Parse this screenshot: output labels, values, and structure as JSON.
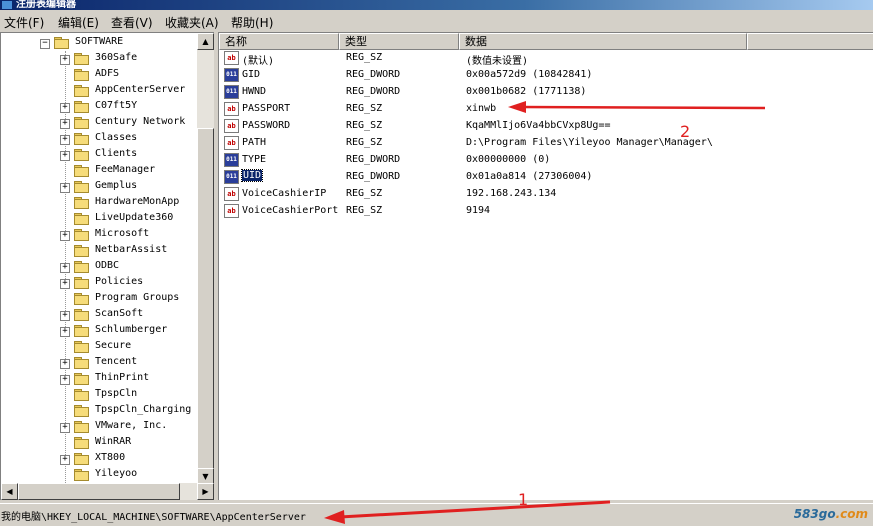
{
  "window": {
    "title": "注册表编辑器"
  },
  "menu": [
    {
      "label": "文件(F)"
    },
    {
      "label": "编辑(E)"
    },
    {
      "label": "查看(V)"
    },
    {
      "label": "收藏夹(A)"
    },
    {
      "label": "帮助(H)"
    }
  ],
  "tree": {
    "root": {
      "label": "SOFTWARE",
      "expander": "−"
    },
    "items": [
      {
        "label": "360Safe",
        "expander": "+"
      },
      {
        "label": "ADFS",
        "expander": ""
      },
      {
        "label": "AppCenterServer",
        "expander": ""
      },
      {
        "label": "C07ft5Y",
        "expander": "+"
      },
      {
        "label": "Century Network",
        "expander": "+"
      },
      {
        "label": "Classes",
        "expander": "+"
      },
      {
        "label": "Clients",
        "expander": "+"
      },
      {
        "label": "FeeManager",
        "expander": ""
      },
      {
        "label": "Gemplus",
        "expander": "+"
      },
      {
        "label": "HardwareMonApp",
        "expander": ""
      },
      {
        "label": "LiveUpdate360",
        "expander": ""
      },
      {
        "label": "Microsoft",
        "expander": "+"
      },
      {
        "label": "NetbarAssist",
        "expander": ""
      },
      {
        "label": "ODBC",
        "expander": "+"
      },
      {
        "label": "Policies",
        "expander": "+"
      },
      {
        "label": "Program Groups",
        "expander": ""
      },
      {
        "label": "ScanSoft",
        "expander": "+"
      },
      {
        "label": "Schlumberger",
        "expander": "+"
      },
      {
        "label": "Secure",
        "expander": ""
      },
      {
        "label": "Tencent",
        "expander": "+"
      },
      {
        "label": "ThinPrint",
        "expander": "+"
      },
      {
        "label": "TpspCln",
        "expander": ""
      },
      {
        "label": "TpspCln_Charging",
        "expander": ""
      },
      {
        "label": "VMware, Inc.",
        "expander": "+"
      },
      {
        "label": "WinRAR",
        "expander": ""
      },
      {
        "label": "XT800",
        "expander": "+"
      },
      {
        "label": "Yileyoo",
        "expander": ""
      }
    ]
  },
  "scroll": {
    "up": "▲",
    "down": "▼",
    "left": "◀",
    "right": "▶"
  },
  "columns": {
    "name": "名称",
    "type": "类型",
    "data": "数据"
  },
  "values": [
    {
      "icon": "ab",
      "name": "(默认)",
      "type": "REG_SZ",
      "data": "(数值未设置)",
      "selected": false
    },
    {
      "icon": "011",
      "name": "GID",
      "type": "REG_DWORD",
      "data": "0x00a572d9 (10842841)",
      "selected": false
    },
    {
      "icon": "011",
      "name": "HWND",
      "type": "REG_DWORD",
      "data": "0x001b0682 (1771138)",
      "selected": false
    },
    {
      "icon": "ab",
      "name": "PASSPORT",
      "type": "REG_SZ",
      "data": "xinwb",
      "selected": false
    },
    {
      "icon": "ab",
      "name": "PASSWORD",
      "type": "REG_SZ",
      "data": "KqaMMlIjo6Va4bbCVxp8Ug==",
      "selected": false
    },
    {
      "icon": "ab",
      "name": "PATH",
      "type": "REG_SZ",
      "data": "D:\\Program Files\\Yileyoo Manager\\Manager\\",
      "selected": false
    },
    {
      "icon": "011",
      "name": "TYPE",
      "type": "REG_DWORD",
      "data": "0x00000000 (0)",
      "selected": false
    },
    {
      "icon": "011",
      "name": "UID",
      "type": "REG_DWORD",
      "data": "0x01a0a814 (27306004)",
      "selected": true
    },
    {
      "icon": "ab",
      "name": "VoiceCashierIP",
      "type": "REG_SZ",
      "data": "192.168.243.134",
      "selected": false
    },
    {
      "icon": "ab",
      "name": "VoiceCashierPort",
      "type": "REG_SZ",
      "data": "9194",
      "selected": false
    }
  ],
  "status": {
    "path": "我的电脑\\HKEY_LOCAL_MACHINE\\SOFTWARE\\AppCenterServer"
  },
  "watermark": {
    "main": "583go",
    "suffix": ".com"
  },
  "annotations": [
    {
      "number": "1",
      "color": "#e02020"
    },
    {
      "number": "2",
      "color": "#e02020"
    }
  ]
}
